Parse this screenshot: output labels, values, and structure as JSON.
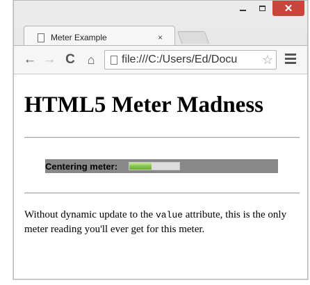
{
  "browser": {
    "tab_title": "Meter Example",
    "tab_close": "×",
    "url": "file:///C:/Users/Ed/Docu",
    "controls": {
      "minimize": "–",
      "close": "✕"
    }
  },
  "page": {
    "heading": "HTML5 Meter Madness",
    "meter": {
      "label": "Centering meter:",
      "value": 0.45,
      "fill_color": "#85c34b"
    },
    "paragraph": {
      "before_code": "Without dynamic update to the ",
      "code": "value",
      "after_code": " attribute, this is the only meter reading you'll ever get for this meter."
    }
  }
}
